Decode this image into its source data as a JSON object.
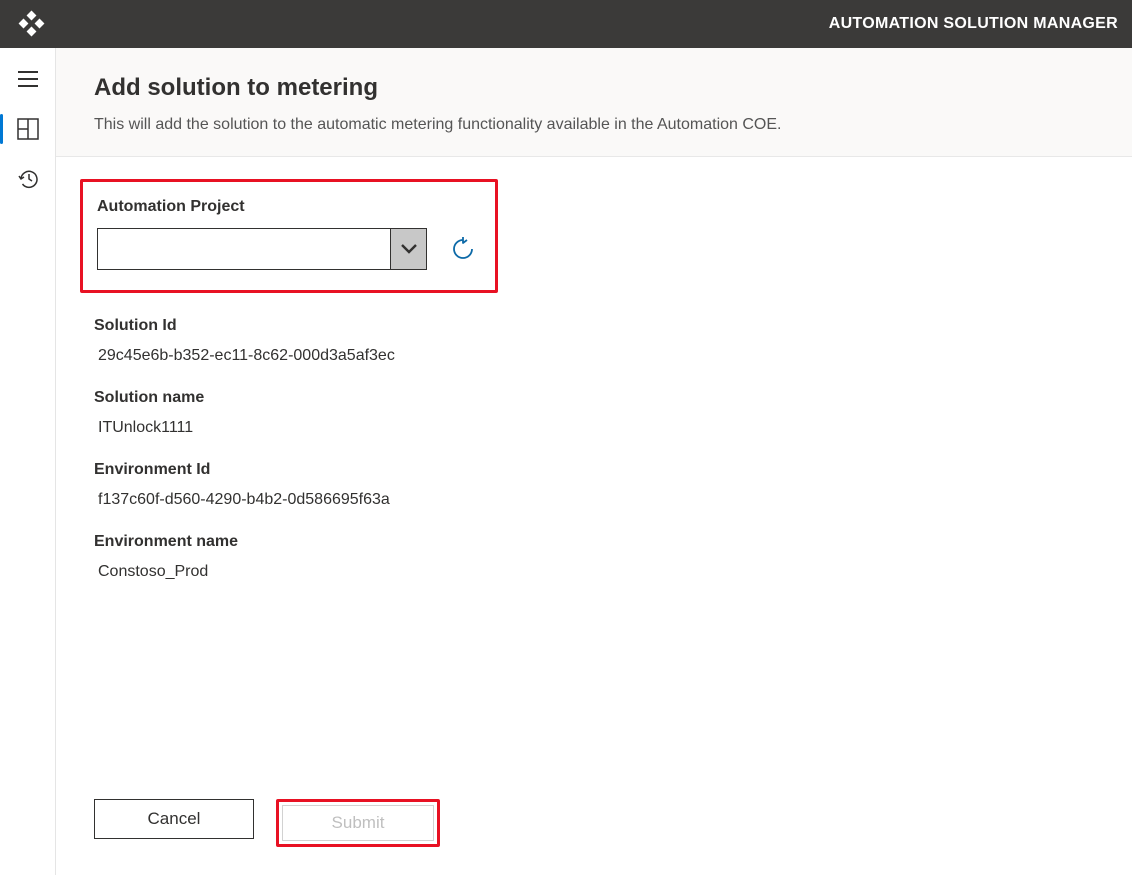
{
  "header": {
    "app_title": "AUTOMATION SOLUTION MANAGER"
  },
  "page": {
    "title": "Add solution to metering",
    "description": "This will add the solution to the automatic metering functionality available in the Automation COE."
  },
  "form": {
    "project_label": "Automation Project",
    "project_value": "",
    "solution_id_label": "Solution Id",
    "solution_id_value": "29c45e6b-b352-ec11-8c62-000d3a5af3ec",
    "solution_name_label": "Solution name",
    "solution_name_value": "ITUnlock1111",
    "environment_id_label": "Environment Id",
    "environment_id_value": "f137c60f-d560-4290-b4b2-0d586695f63a",
    "environment_name_label": "Environment name",
    "environment_name_value": "Constoso_Prod"
  },
  "buttons": {
    "cancel": "Cancel",
    "submit": "Submit"
  }
}
